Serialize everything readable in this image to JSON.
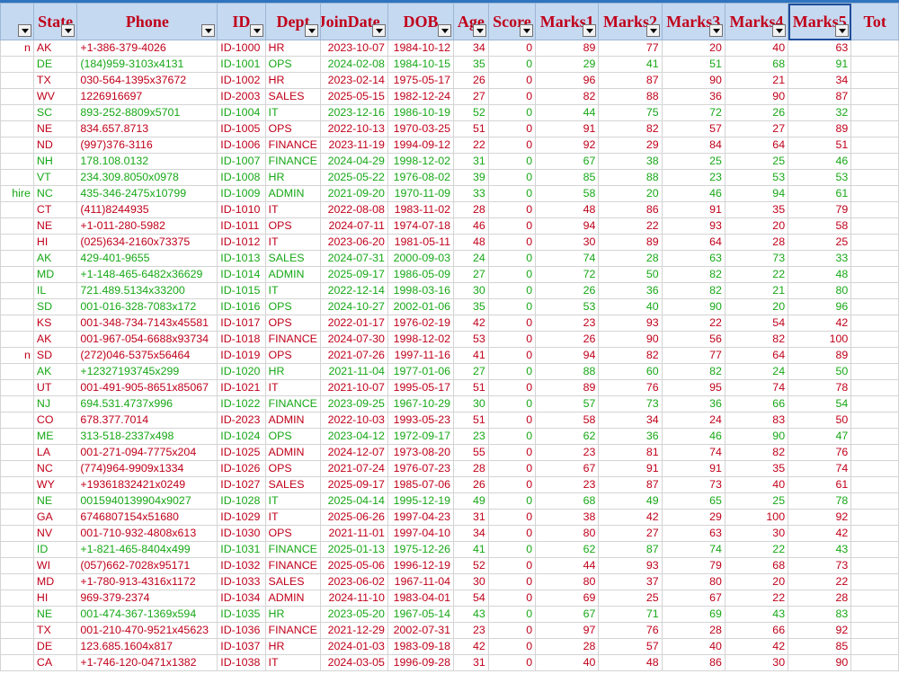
{
  "headers": [
    "",
    "State",
    "Phone",
    "ID",
    "Dept",
    "JoinDate",
    "DOB",
    "Age",
    "Score",
    "Marks1",
    "Marks2",
    "Marks3",
    "Marks4",
    "Marks5",
    "Tot"
  ],
  "selected_header": 13,
  "colors": {
    "red": "#c0001a",
    "green": "#17a817",
    "header_bg": "#c5d9f1"
  },
  "rows": [
    {
      "a": "n",
      "state": "AK",
      "phone": "+1-386-379-4026",
      "id": "ID-1000",
      "dept": "HR",
      "join": "2023-10-07",
      "dob": "1984-10-12",
      "age": "34",
      "score": "0",
      "m1": "89",
      "m2": "77",
      "m3": "20",
      "m4": "40",
      "m5": "63",
      "tone": "red"
    },
    {
      "a": "",
      "state": "DE",
      "phone": "(184)959-3103x4131",
      "id": "ID-1001",
      "dept": "OPS",
      "join": "2024-02-08",
      "dob": "1984-10-15",
      "age": "35",
      "score": "0",
      "m1": "29",
      "m2": "41",
      "m3": "51",
      "m4": "68",
      "m5": "91",
      "tone": "green"
    },
    {
      "a": "",
      "state": "TX",
      "phone": "030-564-1395x37672",
      "id": "ID-1002",
      "dept": "HR",
      "join": "2023-02-14",
      "dob": "1975-05-17",
      "age": "26",
      "score": "0",
      "m1": "96",
      "m2": "87",
      "m3": "90",
      "m4": "21",
      "m5": "34",
      "tone": "red"
    },
    {
      "a": "",
      "state": "WV",
      "phone": "1226916697",
      "id": "ID-2003",
      "dept": "SALES",
      "join": "2025-05-15",
      "dob": "1982-12-24",
      "age": "27",
      "score": "0",
      "m1": "82",
      "m2": "88",
      "m3": "36",
      "m4": "90",
      "m5": "87",
      "tone": "red"
    },
    {
      "a": "",
      "state": "SC",
      "phone": "893-252-8809x5701",
      "id": "ID-1004",
      "dept": "IT",
      "join": "2023-12-16",
      "dob": "1986-10-19",
      "age": "52",
      "score": "0",
      "m1": "44",
      "m2": "75",
      "m3": "72",
      "m4": "26",
      "m5": "32",
      "tone": "green"
    },
    {
      "a": "",
      "state": "NE",
      "phone": "834.657.8713",
      "id": "ID-1005",
      "dept": "OPS",
      "join": "2022-10-13",
      "dob": "1970-03-25",
      "age": "51",
      "score": "0",
      "m1": "91",
      "m2": "82",
      "m3": "57",
      "m4": "27",
      "m5": "89",
      "tone": "red"
    },
    {
      "a": "",
      "state": "ND",
      "phone": "(997)376-3116",
      "id": "ID-1006",
      "dept": "FINANCE",
      "join": "2023-11-19",
      "dob": "1994-09-12",
      "age": "22",
      "score": "0",
      "m1": "92",
      "m2": "29",
      "m3": "84",
      "m4": "64",
      "m5": "51",
      "tone": "red"
    },
    {
      "a": "",
      "state": "NH",
      "phone": "178.108.0132",
      "id": "ID-1007",
      "dept": "FINANCE",
      "join": "2024-04-29",
      "dob": "1998-12-02",
      "age": "31",
      "score": "0",
      "m1": "67",
      "m2": "38",
      "m3": "25",
      "m4": "25",
      "m5": "46",
      "tone": "green"
    },
    {
      "a": "",
      "state": "VT",
      "phone": "234.309.8050x0978",
      "id": "ID-1008",
      "dept": "HR",
      "join": "2025-05-22",
      "dob": "1976-08-02",
      "age": "39",
      "score": "0",
      "m1": "85",
      "m2": "88",
      "m3": "23",
      "m4": "53",
      "m5": "53",
      "tone": "green"
    },
    {
      "a": "hire",
      "state": "NC",
      "phone": "435-346-2475x10799",
      "id": "ID-1009",
      "dept": "ADMIN",
      "join": "2021-09-20",
      "dob": "1970-11-09",
      "age": "33",
      "score": "0",
      "m1": "58",
      "m2": "20",
      "m3": "46",
      "m4": "94",
      "m5": "61",
      "tone": "green"
    },
    {
      "a": "",
      "state": "CT",
      "phone": "(411)8244935",
      "id": "ID-1010",
      "dept": "IT",
      "join": "2022-08-08",
      "dob": "1983-11-02",
      "age": "28",
      "score": "0",
      "m1": "48",
      "m2": "86",
      "m3": "91",
      "m4": "35",
      "m5": "79",
      "tone": "red"
    },
    {
      "a": "",
      "state": "NE",
      "phone": "+1-011-280-5982",
      "id": "ID-1011",
      "dept": "OPS",
      "join": "2024-07-11",
      "dob": "1974-07-18",
      "age": "46",
      "score": "0",
      "m1": "94",
      "m2": "22",
      "m3": "93",
      "m4": "20",
      "m5": "58",
      "tone": "red"
    },
    {
      "a": "",
      "state": "HI",
      "phone": "(025)634-2160x73375",
      "id": "ID-1012",
      "dept": "IT",
      "join": "2023-06-20",
      "dob": "1981-05-11",
      "age": "48",
      "score": "0",
      "m1": "30",
      "m2": "89",
      "m3": "64",
      "m4": "28",
      "m5": "25",
      "tone": "red"
    },
    {
      "a": "",
      "state": "AK",
      "phone": "429-401-9655",
      "id": "ID-1013",
      "dept": "SALES",
      "join": "2024-07-31",
      "dob": "2000-09-03",
      "age": "24",
      "score": "0",
      "m1": "74",
      "m2": "28",
      "m3": "63",
      "m4": "73",
      "m5": "33",
      "tone": "green"
    },
    {
      "a": "",
      "state": "MD",
      "phone": "+1-148-465-6482x36629",
      "id": "ID-1014",
      "dept": "ADMIN",
      "join": "2025-09-17",
      "dob": "1986-05-09",
      "age": "27",
      "score": "0",
      "m1": "72",
      "m2": "50",
      "m3": "82",
      "m4": "22",
      "m5": "48",
      "tone": "green"
    },
    {
      "a": "",
      "state": "IL",
      "phone": "721.489.5134x33200",
      "id": "ID-1015",
      "dept": "IT",
      "join": "2022-12-14",
      "dob": "1998-03-16",
      "age": "30",
      "score": "0",
      "m1": "26",
      "m2": "36",
      "m3": "82",
      "m4": "21",
      "m5": "80",
      "tone": "green"
    },
    {
      "a": "",
      "state": "SD",
      "phone": "001-016-328-7083x172",
      "id": "ID-1016",
      "dept": "OPS",
      "join": "2024-10-27",
      "dob": "2002-01-06",
      "age": "35",
      "score": "0",
      "m1": "53",
      "m2": "40",
      "m3": "90",
      "m4": "20",
      "m5": "96",
      "tone": "green"
    },
    {
      "a": "",
      "state": "KS",
      "phone": "001-348-734-7143x45581",
      "id": "ID-1017",
      "dept": "OPS",
      "join": "2022-01-17",
      "dob": "1976-02-19",
      "age": "42",
      "score": "0",
      "m1": "23",
      "m2": "93",
      "m3": "22",
      "m4": "54",
      "m5": "42",
      "tone": "red"
    },
    {
      "a": "",
      "state": "AK",
      "phone": "001-967-054-6688x93734",
      "id": "ID-1018",
      "dept": "FINANCE",
      "join": "2024-07-30",
      "dob": "1998-12-02",
      "age": "53",
      "score": "0",
      "m1": "26",
      "m2": "90",
      "m3": "56",
      "m4": "82",
      "m5": "100",
      "tone": "red"
    },
    {
      "a": "n",
      "state": "SD",
      "phone": "(272)046-5375x56464",
      "id": "ID-1019",
      "dept": "OPS",
      "join": "2021-07-26",
      "dob": "1997-11-16",
      "age": "41",
      "score": "0",
      "m1": "94",
      "m2": "82",
      "m3": "77",
      "m4": "64",
      "m5": "89",
      "tone": "red"
    },
    {
      "a": "",
      "state": "AK",
      "phone": "+12327193745x299",
      "id": "ID-1020",
      "dept": "HR",
      "join": "2021-11-04",
      "dob": "1977-01-06",
      "age": "27",
      "score": "0",
      "m1": "88",
      "m2": "60",
      "m3": "82",
      "m4": "24",
      "m5": "50",
      "tone": "green"
    },
    {
      "a": "",
      "state": "UT",
      "phone": "001-491-905-8651x85067",
      "id": "ID-1021",
      "dept": "IT",
      "join": "2021-10-07",
      "dob": "1995-05-17",
      "age": "51",
      "score": "0",
      "m1": "89",
      "m2": "76",
      "m3": "95",
      "m4": "74",
      "m5": "78",
      "tone": "red"
    },
    {
      "a": "",
      "state": "NJ",
      "phone": "694.531.4737x996",
      "id": "ID-1022",
      "dept": "FINANCE",
      "join": "2023-09-25",
      "dob": "1967-10-29",
      "age": "30",
      "score": "0",
      "m1": "57",
      "m2": "73",
      "m3": "36",
      "m4": "66",
      "m5": "54",
      "tone": "green"
    },
    {
      "a": "",
      "state": "CO",
      "phone": "678.377.7014",
      "id": "ID-2023",
      "dept": "ADMIN",
      "join": "2022-10-03",
      "dob": "1993-05-23",
      "age": "51",
      "score": "0",
      "m1": "58",
      "m2": "34",
      "m3": "24",
      "m4": "83",
      "m5": "50",
      "tone": "red"
    },
    {
      "a": "",
      "state": "ME",
      "phone": "313-518-2337x498",
      "id": "ID-1024",
      "dept": "OPS",
      "join": "2023-04-12",
      "dob": "1972-09-17",
      "age": "23",
      "score": "0",
      "m1": "62",
      "m2": "36",
      "m3": "46",
      "m4": "90",
      "m5": "47",
      "tone": "green"
    },
    {
      "a": "",
      "state": "LA",
      "phone": "001-271-094-7775x204",
      "id": "ID-1025",
      "dept": "ADMIN",
      "join": "2024-12-07",
      "dob": "1973-08-20",
      "age": "55",
      "score": "0",
      "m1": "23",
      "m2": "81",
      "m3": "74",
      "m4": "82",
      "m5": "76",
      "tone": "red"
    },
    {
      "a": "",
      "state": "NC",
      "phone": "(774)964-9909x1334",
      "id": "ID-1026",
      "dept": "OPS",
      "join": "2021-07-24",
      "dob": "1976-07-23",
      "age": "28",
      "score": "0",
      "m1": "67",
      "m2": "91",
      "m3": "91",
      "m4": "35",
      "m5": "74",
      "tone": "red"
    },
    {
      "a": "",
      "state": "WY",
      "phone": "+19361832421x0249",
      "id": "ID-1027",
      "dept": "SALES",
      "join": "2025-09-17",
      "dob": "1985-07-06",
      "age": "26",
      "score": "0",
      "m1": "23",
      "m2": "87",
      "m3": "73",
      "m4": "40",
      "m5": "61",
      "tone": "red"
    },
    {
      "a": "",
      "state": "NE",
      "phone": "0015940139904x9027",
      "id": "ID-1028",
      "dept": "IT",
      "join": "2025-04-14",
      "dob": "1995-12-19",
      "age": "49",
      "score": "0",
      "m1": "68",
      "m2": "49",
      "m3": "65",
      "m4": "25",
      "m5": "78",
      "tone": "green"
    },
    {
      "a": "",
      "state": "GA",
      "phone": "6746807154x51680",
      "id": "ID-1029",
      "dept": "IT",
      "join": "2025-06-26",
      "dob": "1997-04-23",
      "age": "31",
      "score": "0",
      "m1": "38",
      "m2": "42",
      "m3": "29",
      "m4": "100",
      "m5": "92",
      "tone": "red"
    },
    {
      "a": "",
      "state": "NV",
      "phone": "001-710-932-4808x613",
      "id": "ID-1030",
      "dept": "OPS",
      "join": "2021-11-01",
      "dob": "1997-04-10",
      "age": "34",
      "score": "0",
      "m1": "80",
      "m2": "27",
      "m3": "63",
      "m4": "30",
      "m5": "42",
      "tone": "red"
    },
    {
      "a": "",
      "state": "ID",
      "phone": "+1-821-465-8404x499",
      "id": "ID-1031",
      "dept": "FINANCE",
      "join": "2025-01-13",
      "dob": "1975-12-26",
      "age": "41",
      "score": "0",
      "m1": "62",
      "m2": "87",
      "m3": "74",
      "m4": "22",
      "m5": "43",
      "tone": "green"
    },
    {
      "a": "",
      "state": "WI",
      "phone": "(057)662-7028x95171",
      "id": "ID-1032",
      "dept": "FINANCE",
      "join": "2025-05-06",
      "dob": "1996-12-19",
      "age": "52",
      "score": "0",
      "m1": "44",
      "m2": "93",
      "m3": "79",
      "m4": "68",
      "m5": "73",
      "tone": "red"
    },
    {
      "a": "",
      "state": "MD",
      "phone": "+1-780-913-4316x1172",
      "id": "ID-1033",
      "dept": "SALES",
      "join": "2023-06-02",
      "dob": "1967-11-04",
      "age": "30",
      "score": "0",
      "m1": "80",
      "m2": "37",
      "m3": "80",
      "m4": "20",
      "m5": "22",
      "tone": "red"
    },
    {
      "a": "",
      "state": "HI",
      "phone": "969-379-2374",
      "id": "ID-1034",
      "dept": "ADMIN",
      "join": "2024-11-10",
      "dob": "1983-04-01",
      "age": "54",
      "score": "0",
      "m1": "69",
      "m2": "25",
      "m3": "67",
      "m4": "22",
      "m5": "28",
      "tone": "red"
    },
    {
      "a": "",
      "state": "NE",
      "phone": "001-474-367-1369x594",
      "id": "ID-1035",
      "dept": "HR",
      "join": "2023-05-20",
      "dob": "1967-05-14",
      "age": "43",
      "score": "0",
      "m1": "67",
      "m2": "71",
      "m3": "69",
      "m4": "43",
      "m5": "83",
      "tone": "green"
    },
    {
      "a": "",
      "state": "TX",
      "phone": "001-210-470-9521x45623",
      "id": "ID-1036",
      "dept": "FINANCE",
      "join": "2021-12-29",
      "dob": "2002-07-31",
      "age": "23",
      "score": "0",
      "m1": "97",
      "m2": "76",
      "m3": "28",
      "m4": "66",
      "m5": "92",
      "tone": "red"
    },
    {
      "a": "",
      "state": "DE",
      "phone": "123.685.1604x817",
      "id": "ID-1037",
      "dept": "HR",
      "join": "2024-01-03",
      "dob": "1983-09-18",
      "age": "42",
      "score": "0",
      "m1": "28",
      "m2": "57",
      "m3": "40",
      "m4": "42",
      "m5": "85",
      "tone": "red"
    },
    {
      "a": "",
      "state": "CA",
      "phone": "+1-746-120-0471x1382",
      "id": "ID-1038",
      "dept": "IT",
      "join": "2024-03-05",
      "dob": "1996-09-28",
      "age": "31",
      "score": "0",
      "m1": "40",
      "m2": "48",
      "m3": "86",
      "m4": "30",
      "m5": "90",
      "tone": "red"
    }
  ]
}
